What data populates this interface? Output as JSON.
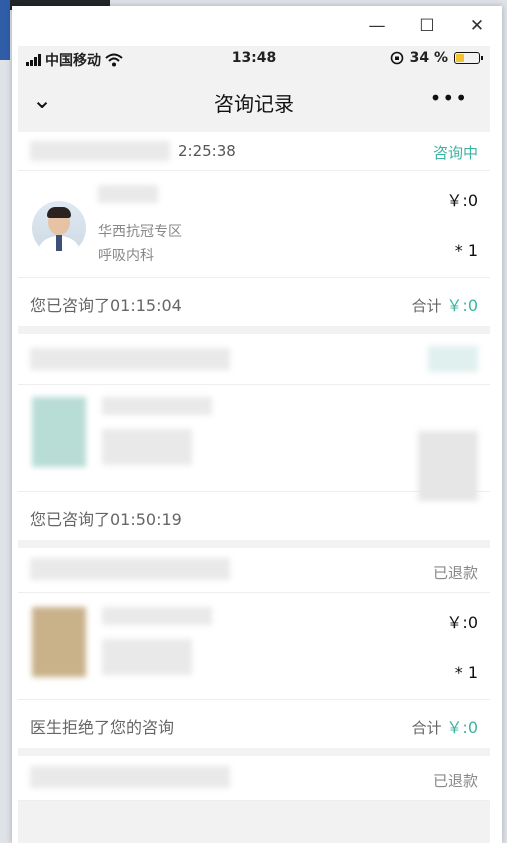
{
  "window": {
    "minimize_glyph": "—",
    "maximize_glyph": "☐",
    "close_glyph": "✕"
  },
  "status_bar": {
    "carrier": "中国移动",
    "time": "13:48",
    "battery_percent": "34 %",
    "battery_level": 0.34
  },
  "nav": {
    "title": "咨询记录",
    "back_icon": "chevron-down-icon",
    "more_label": "•••"
  },
  "colors": {
    "accent": "#3db4a0",
    "muted": "#888888",
    "battery": "#f2c230"
  },
  "orders": [
    {
      "time_fragment": "2:25:38",
      "status": "咨询中",
      "doctor_name": "",
      "department": "华西抗冠专区",
      "section": "呼吸内科",
      "price": "￥:0",
      "quantity": "* 1",
      "duration": "您已咨询了01:15:04",
      "total_label": "合计",
      "total_amount": "￥:0"
    },
    {
      "time_fragment": "",
      "status": "",
      "duration": "您已咨询了01:50:19"
    },
    {
      "time_fragment": "",
      "status": "已退款",
      "price": "￥:0",
      "quantity": "* 1",
      "duration": "医生拒绝了您的咨询",
      "total_label": "合计",
      "total_amount": "￥:0"
    },
    {
      "time_fragment": "",
      "status": "已退款"
    }
  ]
}
